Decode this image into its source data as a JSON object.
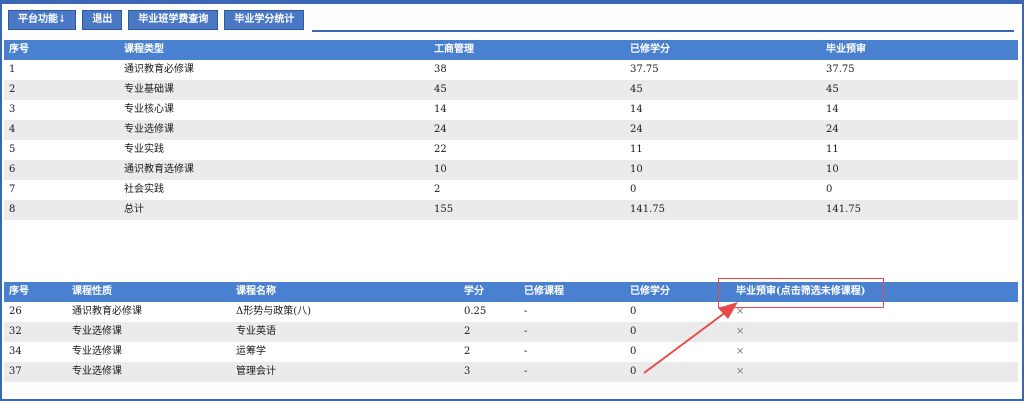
{
  "toolbar": {
    "tabs": [
      "平台功能↓",
      "退出",
      "毕业班学费查询",
      "毕业学分统计"
    ]
  },
  "summary_table": {
    "headers": [
      "序号",
      "课程类型",
      "工商管理",
      "已修学分",
      "毕业预审"
    ],
    "rows": [
      [
        "1",
        "通识教育必修课",
        "38",
        "37.75",
        "37.75"
      ],
      [
        "2",
        "专业基础课",
        "45",
        "45",
        "45"
      ],
      [
        "3",
        "专业核心课",
        "14",
        "14",
        "14"
      ],
      [
        "4",
        "专业选修课",
        "24",
        "24",
        "24"
      ],
      [
        "5",
        "专业实践",
        "22",
        "11",
        "11"
      ],
      [
        "6",
        "通识教育选修课",
        "10",
        "10",
        "10"
      ],
      [
        "7",
        "社会实践",
        "2",
        "0",
        "0"
      ],
      [
        "8",
        "总计",
        "155",
        "141.75",
        "141.75"
      ]
    ]
  },
  "detail_table": {
    "headers": [
      "序号",
      "课程性质",
      "课程名称",
      "学分",
      "已修课程",
      "已修学分",
      "毕业预审(点击筛选未修课程)"
    ],
    "rows": [
      [
        "26",
        "通识教育必修课",
        "Δ形势与政策(八)",
        "0.25",
        "-",
        "0",
        "×"
      ],
      [
        "32",
        "专业选修课",
        "专业英语",
        "2",
        "-",
        "0",
        "×"
      ],
      [
        "34",
        "专业选修课",
        "运筹学",
        "2",
        "-",
        "0",
        "×"
      ],
      [
        "37",
        "专业选修课",
        "管理会计",
        "3",
        "-",
        "0",
        "×"
      ]
    ]
  },
  "colors": {
    "accent": "#4a80d0",
    "highlight": "#e84a4a"
  }
}
